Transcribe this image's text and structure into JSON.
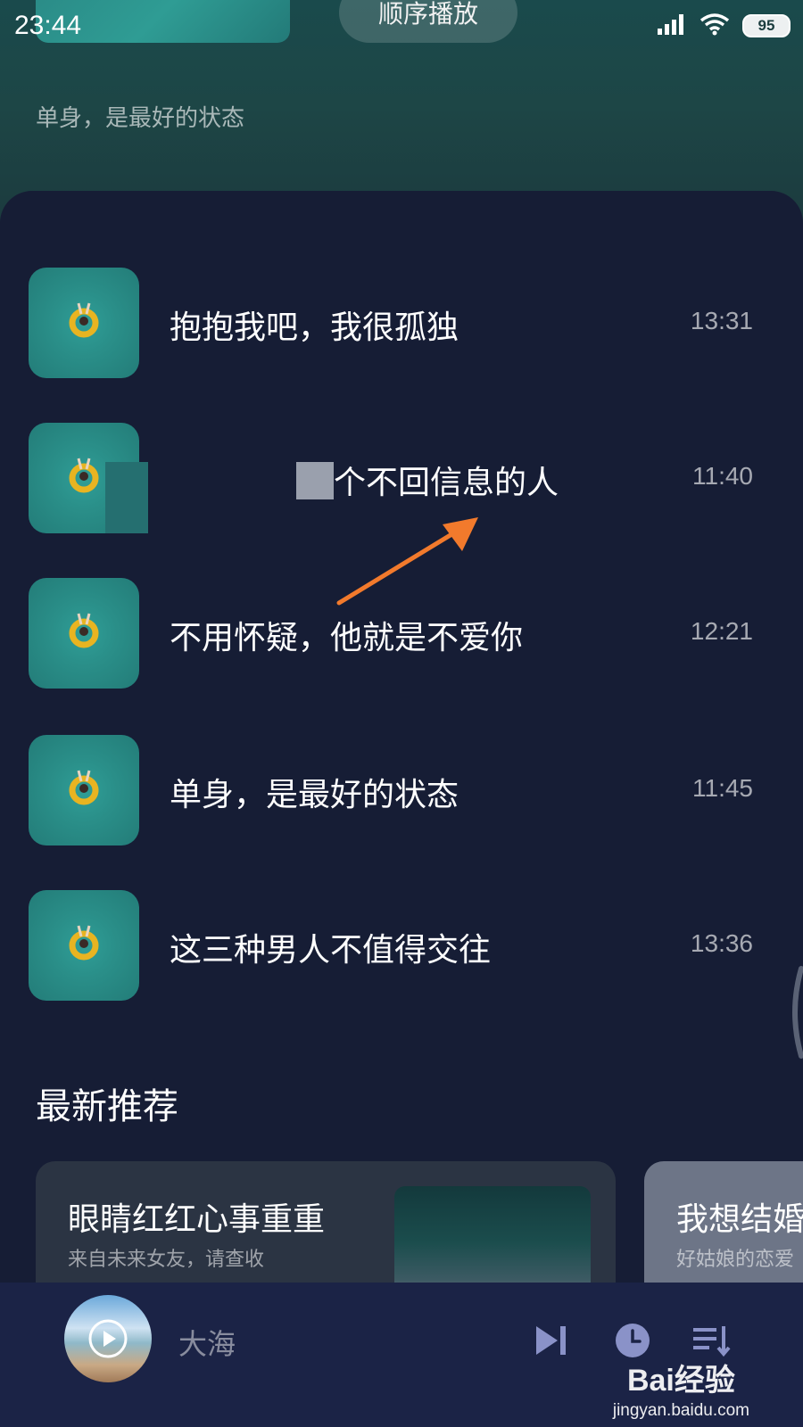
{
  "status_bar": {
    "time": "23:44",
    "battery": "95",
    "icons": [
      "signal-icon",
      "wifi-icon",
      "battery-icon"
    ]
  },
  "header": {
    "play_mode": "顺序播放",
    "subtitle": "单身，是最好的状态"
  },
  "tracks": [
    {
      "title": "抱抱我吧，我很孤独",
      "time": "13:31"
    },
    {
      "title": "个不回信息的人",
      "time": "11:40"
    },
    {
      "title": "不用怀疑，他就是不爱你",
      "time": "12:21"
    },
    {
      "title": "单身，是最好的状态",
      "time": "11:45"
    },
    {
      "title": "这三种男人不值得交往",
      "time": "13:36"
    }
  ],
  "recommend": {
    "section_title": "最新推荐",
    "cards": [
      {
        "title": "眼睛红红心事重重",
        "subtitle": "来自未来女友，请查收"
      },
      {
        "title": "我想结婚",
        "subtitle": "好姑娘的恋爱"
      }
    ]
  },
  "player": {
    "track_name": "大海",
    "icons": [
      "play-icon",
      "next-track-icon",
      "timer-icon",
      "playlist-icon"
    ]
  },
  "watermark": {
    "brand": "Bai经验",
    "url": "jingyan.baidu.com"
  },
  "colors": {
    "background": "#161d35",
    "header": "#1d4646",
    "player": "#1b2346",
    "accent_arrow": "#f27a2c"
  }
}
